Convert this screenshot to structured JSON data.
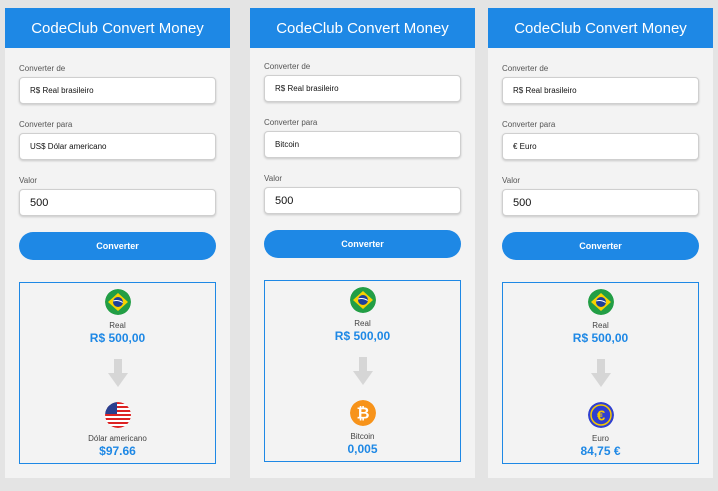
{
  "colors": {
    "accent": "#1e88e5",
    "panel_bg": "#f3f3f3",
    "page_bg": "#e4e4e4"
  },
  "panels": [
    {
      "title": "CodeClub Convert Money",
      "from_label": "Converter de",
      "from_value": "R$ Real brasileiro",
      "to_label": "Converter para",
      "to_value": "US$ Dólar americano",
      "amount_label": "Valor",
      "amount_value": "500",
      "button_label": "Converter",
      "source": {
        "name": "Real",
        "amount": "R$ 500,00",
        "icon": "brazil-flag-icon"
      },
      "target": {
        "name": "Dólar americano",
        "amount": "$97.66",
        "icon": "usa-flag-icon"
      }
    },
    {
      "title": "CodeClub Convert Money",
      "from_label": "Converter de",
      "from_value": "R$ Real brasileiro",
      "to_label": "Converter para",
      "to_value": "Bitcoin",
      "amount_label": "Valor",
      "amount_value": "500",
      "button_label": "Converter",
      "source": {
        "name": "Real",
        "amount": "R$ 500,00",
        "icon": "brazil-flag-icon"
      },
      "target": {
        "name": "Bitcoin",
        "amount": "0,005",
        "icon": "bitcoin-icon"
      }
    },
    {
      "title": "CodeClub Convert Money",
      "from_label": "Converter de",
      "from_value": "R$ Real brasileiro",
      "to_label": "Converter para",
      "to_value": "€ Euro",
      "amount_label": "Valor",
      "amount_value": "500",
      "button_label": "Converter",
      "source": {
        "name": "Real",
        "amount": "R$ 500,00",
        "icon": "brazil-flag-icon"
      },
      "target": {
        "name": "Euro",
        "amount": "84,75 €",
        "icon": "euro-icon"
      }
    }
  ]
}
